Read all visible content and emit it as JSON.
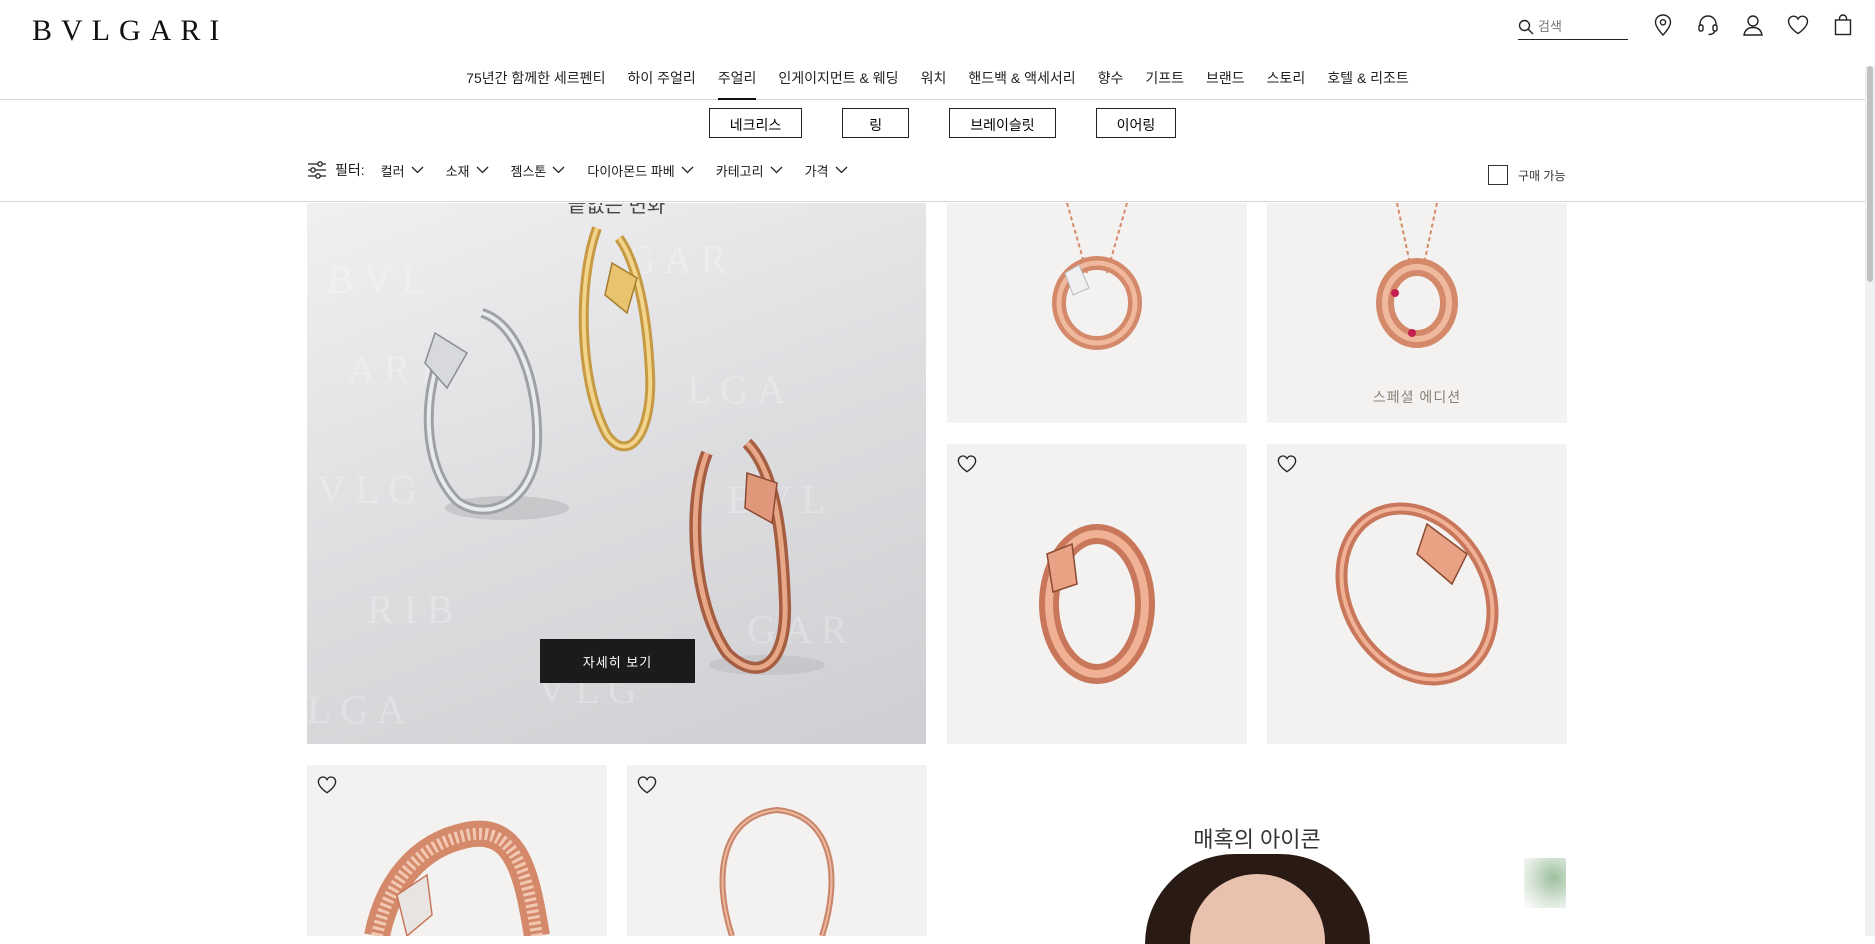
{
  "brand": {
    "logo": "BVLGARI"
  },
  "search": {
    "placeholder": "검색",
    "icon": "search-icon"
  },
  "header_icons": [
    "location-pin-icon",
    "headset-icon",
    "account-icon",
    "wishlist-heart-icon",
    "shopping-bag-icon"
  ],
  "nav": {
    "items": [
      {
        "label": "75년간 함께한 세르펜티"
      },
      {
        "label": "하이 주얼리"
      },
      {
        "label": "주얼리",
        "active": true
      },
      {
        "label": "인게이지먼트 & 웨딩"
      },
      {
        "label": "워치"
      },
      {
        "label": "핸드백 & 액세서리"
      },
      {
        "label": "향수"
      },
      {
        "label": "기프트"
      },
      {
        "label": "브랜드"
      },
      {
        "label": "스토리"
      },
      {
        "label": "호텔 & 리조트"
      }
    ]
  },
  "subcategories": [
    {
      "label": "네크리스"
    },
    {
      "label": "링"
    },
    {
      "label": "브레이슬릿"
    },
    {
      "label": "이어링"
    }
  ],
  "filters": {
    "label": "필터:",
    "items": [
      {
        "label": "컬러"
      },
      {
        "label": "소재"
      },
      {
        "label": "젬스톤"
      },
      {
        "label": "다이아몬드 파베"
      },
      {
        "label": "카테고리"
      },
      {
        "label": "가격"
      }
    ],
    "available_label": "구매 가능"
  },
  "hero": {
    "title": "끝없는 변화",
    "button_label": "자세히 보기"
  },
  "products": [
    {
      "badge": ""
    },
    {
      "badge": "스페셜 에디션"
    },
    {
      "badge": ""
    },
    {
      "badge": ""
    },
    {
      "badge": ""
    },
    {
      "badge": ""
    }
  ],
  "section": {
    "title": "매혹의 아이콘"
  },
  "colors": {
    "rose_gold": "#d48a6a",
    "card_bg": "#f4f2f1",
    "button_bg": "#1b1b1b"
  }
}
